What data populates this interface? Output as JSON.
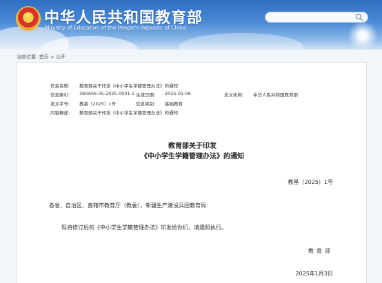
{
  "header": {
    "title": "中华人民共和国教育部",
    "subtitle": "Ministry of Education of the People's Republic of China",
    "search_placeholder": ""
  },
  "breadcrumb": {
    "prefix": "当前位置:",
    "home": "首页",
    "separator": ">",
    "section": "公开"
  },
  "meta": {
    "info_name_label": "信息名称:",
    "info_name_value": "教育部关于印发《中小学生学籍管理办法》的通知",
    "info_index_label": "信息索引:",
    "info_index_value": "360A06-05-2025-0001-1",
    "created_date_label": "生成日期:",
    "created_date_value": "2025-01-06",
    "issuer_label": "发文机构:",
    "issuer_value": "中华人民共和国教育部",
    "doc_number_label": "发文字号:",
    "doc_number_value": "教基〔2025〕1号",
    "category_label": "信息类别:",
    "category_value": "基础教育",
    "summary_label": "内容概述:",
    "summary_value": "教育部关于印发《中小学生学籍管理办法》的通知"
  },
  "document": {
    "title_line1": "教育部关于印发",
    "title_line2": "《中小学生学籍管理办法》的通知",
    "number": "教基〔2025〕1号",
    "salutation": "各省、自治区、直辖市教育厅（教委），新疆生产建设兵团教育局:",
    "body": "现将修订后的《中小学生学籍管理办法》印发给你们，请遵照执行。",
    "signatory": "教育部",
    "date": "2025年1月3日"
  },
  "colors": {
    "header_top": "#2f6fc1",
    "header_bottom": "#cfe2f6",
    "page_background": "#f2f6fb"
  }
}
